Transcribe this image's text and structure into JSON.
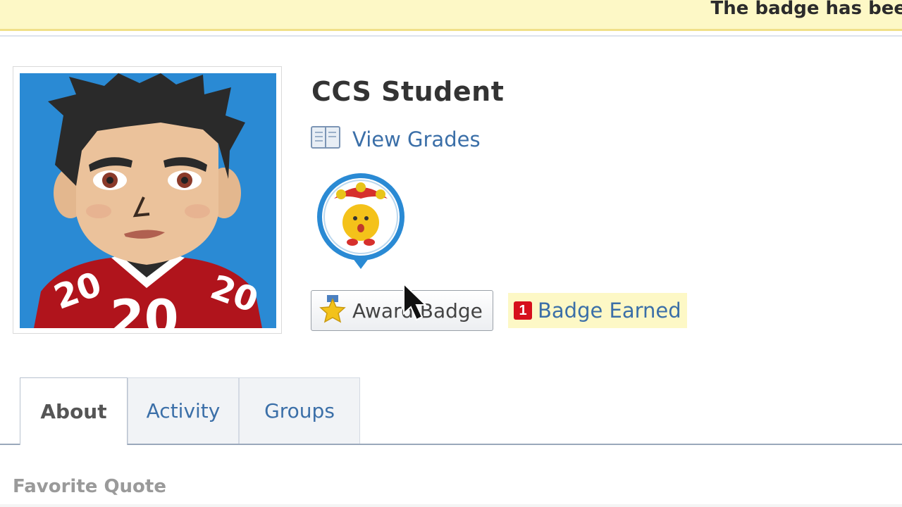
{
  "notice": {
    "text": "The badge has bee"
  },
  "profile": {
    "name": "CCS Student",
    "view_grades_label": "View Grades",
    "award_badge_label": "Award Badge",
    "badge_count": "1",
    "badge_earned_label": "Badge Earned"
  },
  "tabs": [
    {
      "label": "About",
      "active": true
    },
    {
      "label": "Activity",
      "active": false
    },
    {
      "label": "Groups",
      "active": false
    }
  ],
  "section": {
    "label": "Favorite Quote"
  },
  "colors": {
    "notice_bg": "#fdf8c6",
    "link": "#3b6fa8",
    "count_badge": "#d6101c",
    "avatar_bg": "#2a8ad4",
    "jersey": "#b0141c"
  },
  "icons": [
    "book-icon",
    "star-medal-icon",
    "mouse-cursor-icon",
    "badge-medal-icon"
  ]
}
